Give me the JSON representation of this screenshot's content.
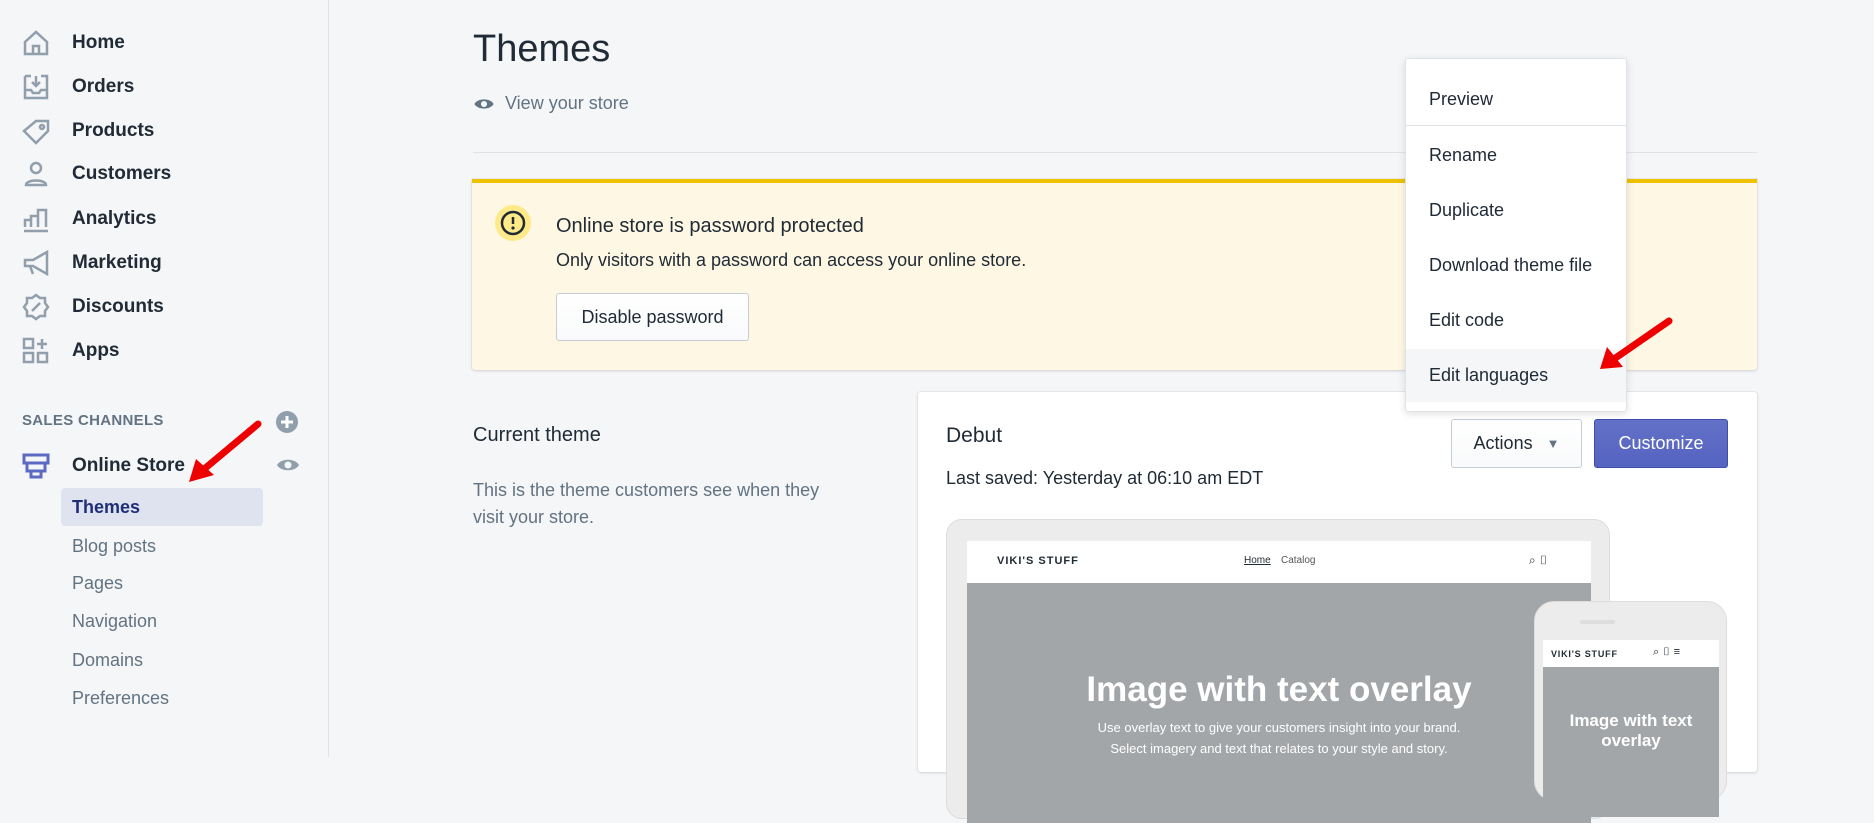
{
  "sidebar": {
    "items": [
      {
        "label": "Home",
        "icon": "home-icon"
      },
      {
        "label": "Orders",
        "icon": "orders-icon"
      },
      {
        "label": "Products",
        "icon": "tag-icon"
      },
      {
        "label": "Customers",
        "icon": "person-icon"
      },
      {
        "label": "Analytics",
        "icon": "bar-chart-icon"
      },
      {
        "label": "Marketing",
        "icon": "megaphone-icon"
      },
      {
        "label": "Discounts",
        "icon": "discount-icon"
      },
      {
        "label": "Apps",
        "icon": "apps-icon"
      }
    ],
    "sales_channels": "SALES CHANNELS",
    "online_store": "Online Store",
    "sub_items": [
      "Themes",
      "Blog posts",
      "Pages",
      "Navigation",
      "Domains",
      "Preferences"
    ]
  },
  "header": {
    "title": "Themes",
    "view_store": "View your store"
  },
  "banner": {
    "title": "Online store is password protected",
    "text": "Only visitors with a password can access your online store.",
    "button": "Disable password"
  },
  "current": {
    "heading": "Current theme",
    "description": "This is the theme customers see when they visit your store."
  },
  "theme": {
    "name": "Debut",
    "last_saved": "Last saved: Yesterday at 06:10 am EDT",
    "actions": "Actions",
    "customize": "Customize",
    "preview": {
      "store": "VIKI'S STUFF",
      "nav_home": "Home",
      "nav_catalog": "Catalog",
      "hero": "Image with text overlay",
      "hero_sub1": "Use overlay text to give your customers insight into your brand.",
      "hero_sub2": "Select imagery and text that relates to your style and story.",
      "mobile_hero": "Image with text overlay"
    }
  },
  "dropdown": [
    "Preview",
    "Rename",
    "Duplicate",
    "Download theme file",
    "Edit code",
    "Edit languages"
  ],
  "colors": {
    "accent": "#5c6ac4",
    "warning": "#eec200",
    "arrow": "#e00000"
  }
}
